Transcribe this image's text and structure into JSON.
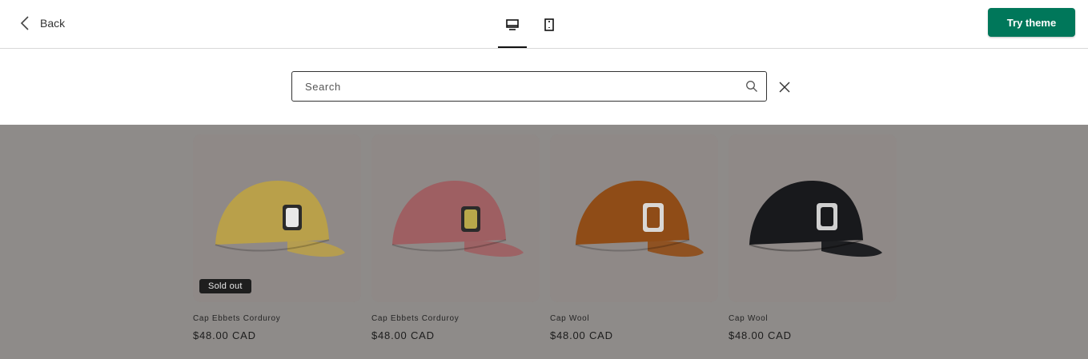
{
  "header": {
    "back_label": "Back",
    "try_theme_label": "Try theme",
    "devices": [
      {
        "icon": "desktop-icon",
        "active": true
      },
      {
        "icon": "mobile-icon",
        "active": false
      }
    ]
  },
  "search": {
    "placeholder": "Search",
    "value": ""
  },
  "products": [
    {
      "title": "Cap Ebbets Corduroy",
      "price": "$48.00 CAD",
      "badge": "Sold out",
      "cap_color": "#b9a04a"
    },
    {
      "title": "Cap Ebbets Corduroy",
      "price": "$48.00 CAD",
      "badge": "",
      "cap_color": "#9e5f62"
    },
    {
      "title": "Cap Wool",
      "price": "$48.00 CAD",
      "badge": "",
      "cap_color": "#8f4c17"
    },
    {
      "title": "Cap Wool",
      "price": "$48.00 CAD",
      "badge": "",
      "cap_color": "#18191c"
    }
  ],
  "colors": {
    "accent": "#00775a",
    "overlay": "#8e8b89"
  }
}
